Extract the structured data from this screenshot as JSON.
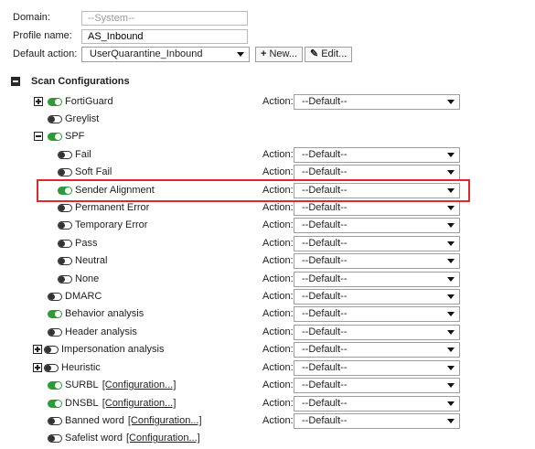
{
  "form": {
    "domain_label": "Domain:",
    "domain_value": "--System--",
    "profile_label": "Profile name:",
    "profile_value": "AS_Inbound",
    "default_action_label": "Default action:",
    "default_action_value": "UserQuarantine_Inbound",
    "new_button": "New...",
    "edit_button": "Edit..."
  },
  "scan_title": "Scan Configurations",
  "action_label": "Action:",
  "default_option": "--Default--",
  "items": [
    {
      "label": "FortiGuard",
      "on": true,
      "expander": "plus",
      "action": true
    },
    {
      "label": "Greylist",
      "on": false,
      "action": false
    },
    {
      "label": "SPF",
      "on": true,
      "expander": "minus",
      "action": false
    },
    {
      "label": "Fail",
      "on": false,
      "action": true
    },
    {
      "label": "Soft Fail",
      "on": false,
      "action": true
    },
    {
      "label": "Sender Alignment",
      "on": true,
      "action": true,
      "highlighted": true
    },
    {
      "label": "Permanent Error",
      "on": false,
      "action": true
    },
    {
      "label": "Temporary Error",
      "on": false,
      "action": true
    },
    {
      "label": "Pass",
      "on": false,
      "action": true
    },
    {
      "label": "Neutral",
      "on": false,
      "action": true
    },
    {
      "label": "None",
      "on": false,
      "action": true
    },
    {
      "label": "DMARC",
      "on": false,
      "action": true
    },
    {
      "label": "Behavior analysis",
      "on": true,
      "action": true
    },
    {
      "label": "Header analysis",
      "on": false,
      "action": true
    },
    {
      "label": "Impersonation analysis",
      "on": false,
      "expander": "plus",
      "action": true
    },
    {
      "label": "Heuristic",
      "on": false,
      "expander": "plus",
      "action": true
    },
    {
      "label": "SURBL",
      "on": true,
      "action": true,
      "config": "[Configuration...]"
    },
    {
      "label": "DNSBL",
      "on": true,
      "action": true,
      "config": "[Configuration...]"
    },
    {
      "label": "Banned word",
      "on": false,
      "action": true,
      "config": "[Configuration...]"
    },
    {
      "label": "Safelist word",
      "on": false,
      "action": false,
      "config": "[Configuration...]"
    }
  ],
  "colors": {
    "toggle_on": "#2e9a3b",
    "highlight": "#e0282e"
  }
}
